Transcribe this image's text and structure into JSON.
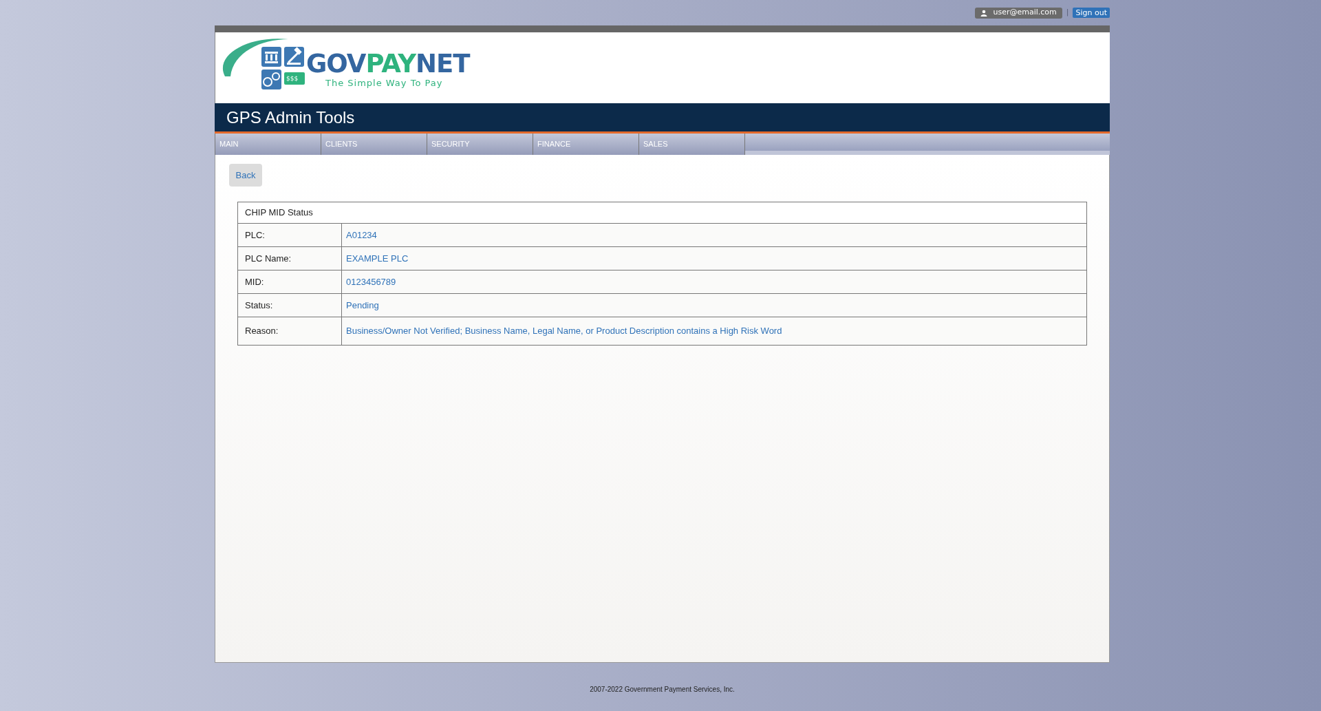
{
  "user_bar": {
    "user": "user@email.com",
    "separator": "|",
    "sign_out": "Sign out"
  },
  "logo": {
    "wordmark_parts": [
      "GOV",
      "PAY",
      "NET"
    ],
    "tagline": "The Simple Way To Pay",
    "dollar_sign": "$$$"
  },
  "app_title": "GPS Admin Tools",
  "nav": [
    {
      "label": "MAIN"
    },
    {
      "label": "CLIENTS"
    },
    {
      "label": "SECURITY"
    },
    {
      "label": "FINANCE"
    },
    {
      "label": "SALES"
    }
  ],
  "back_button": "Back",
  "panel": {
    "title": "CHIP MID Status",
    "rows": [
      {
        "label": "PLC:",
        "value": "A01234"
      },
      {
        "label": "PLC Name:",
        "value": "EXAMPLE PLC"
      },
      {
        "label": "MID:",
        "value": "0123456789"
      },
      {
        "label": "Status:",
        "value": "Pending"
      },
      {
        "label": "Reason:",
        "value": "Business/Owner Not Verified; Business Name, Legal Name, or Product Description contains a High Risk Word"
      }
    ]
  },
  "footer": "2007-2022 Government Payment Services, Inc."
}
